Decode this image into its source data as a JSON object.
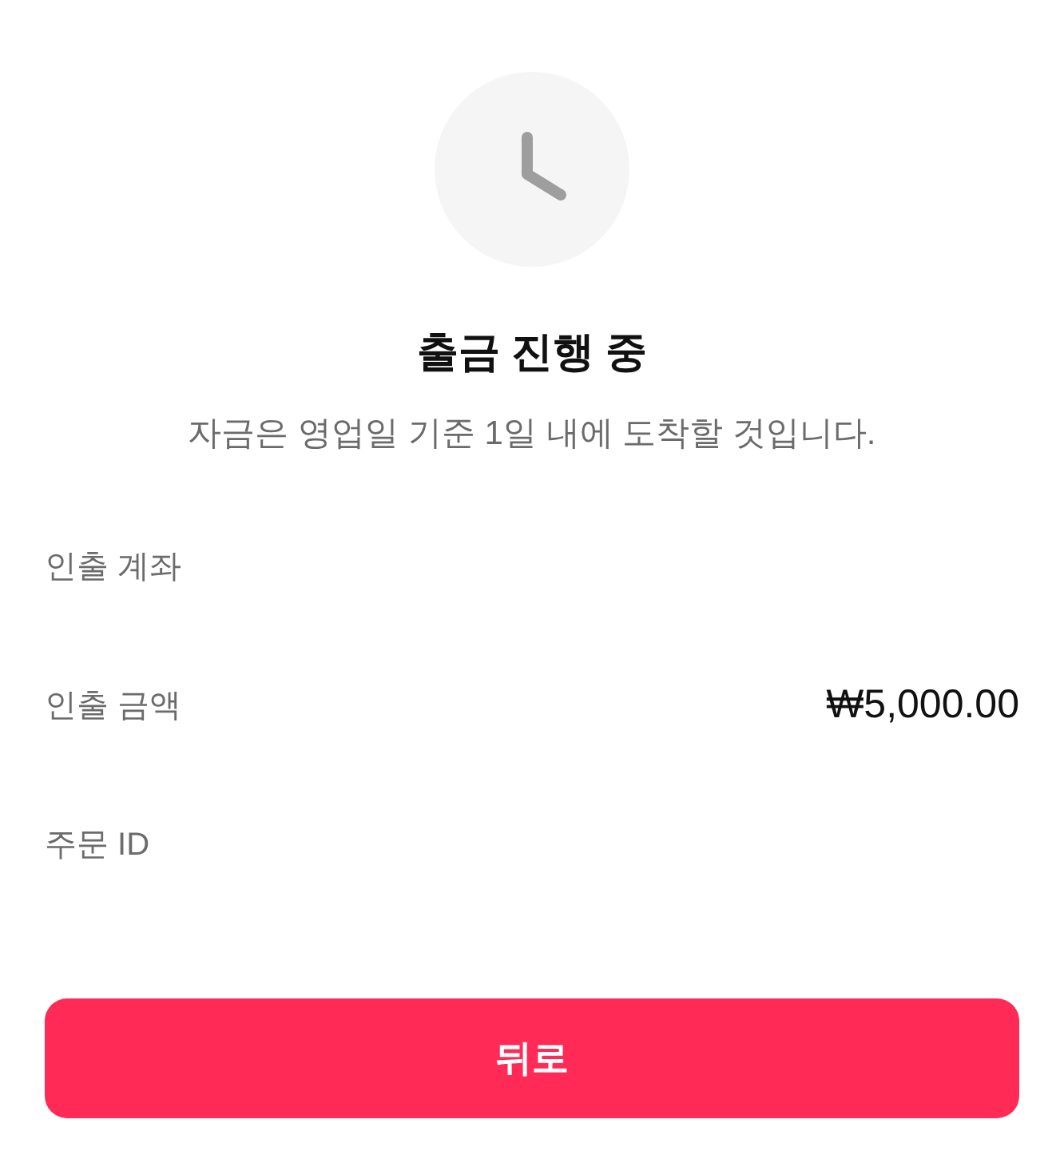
{
  "status": {
    "title": "출금 진행 중",
    "message": "자금은 영업일 기준 1일 내에 도착할 것입니다."
  },
  "details": [
    {
      "label": "인출 계좌"
    },
    {
      "label": "인출 금액",
      "value": "₩5,000.00"
    },
    {
      "label": "주문 ID"
    }
  ],
  "button": {
    "label": "뒤로"
  }
}
